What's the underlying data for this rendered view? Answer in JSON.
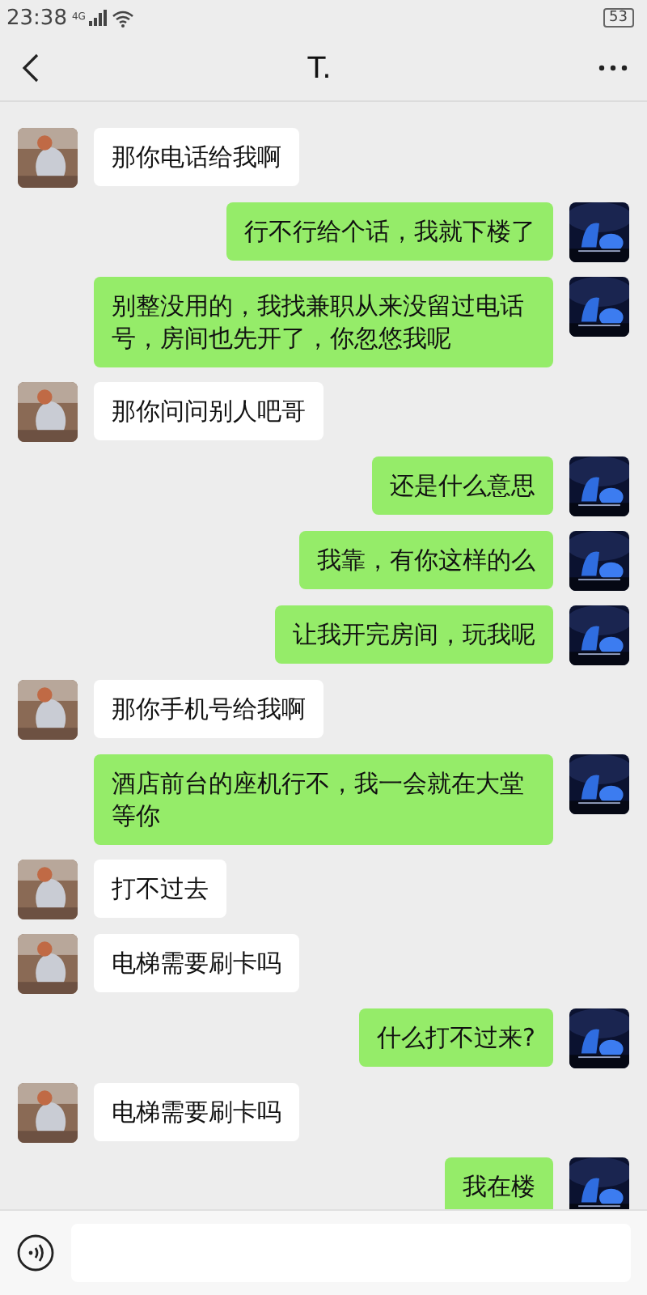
{
  "status_bar": {
    "time": "23:38",
    "network": "4G",
    "battery": "53"
  },
  "header": {
    "title": "T."
  },
  "messages": [
    {
      "kind": "incoming",
      "text": "那你电话给我啊"
    },
    {
      "kind": "outgoing",
      "text": "行不行给个话，我就下楼了"
    },
    {
      "kind": "outgoing",
      "text": "别整没用的，我找兼职从来没留过电话号，房间也先开了，你忽悠我呢"
    },
    {
      "kind": "incoming",
      "text": "那你问问别人吧哥"
    },
    {
      "kind": "outgoing",
      "text": "还是什么意思"
    },
    {
      "kind": "outgoing",
      "text": "我靠，有你这样的么"
    },
    {
      "kind": "outgoing",
      "text": "让我开完房间，玩我呢"
    },
    {
      "kind": "incoming",
      "text": "那你手机号给我啊"
    },
    {
      "kind": "outgoing",
      "text": "酒店前台的座机行不，我一会就在大堂等你"
    },
    {
      "kind": "incoming",
      "text": "打不过去"
    },
    {
      "kind": "incoming",
      "text": "电梯需要刷卡吗"
    },
    {
      "kind": "outgoing",
      "text": "什么打不过来?"
    },
    {
      "kind": "incoming",
      "text": "电梯需要刷卡吗"
    },
    {
      "kind": "outgoing",
      "text": "我在楼"
    }
  ]
}
